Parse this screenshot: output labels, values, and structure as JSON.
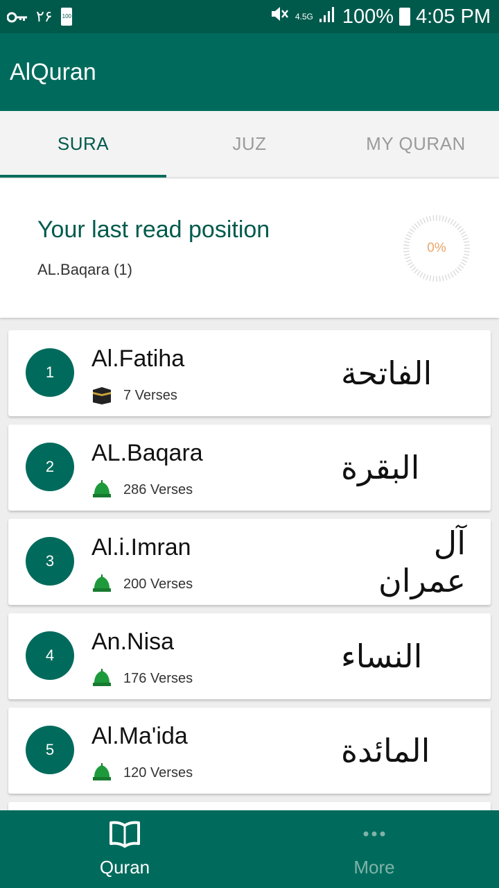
{
  "status_bar": {
    "left_text": "۲۶",
    "battery_small": "100",
    "network": "4.5G",
    "battery_percent": "100%",
    "time": "4:05 PM"
  },
  "app": {
    "title": "AlQuran"
  },
  "tabs": [
    {
      "label": "SURA",
      "active": true
    },
    {
      "label": "JUZ",
      "active": false
    },
    {
      "label": "MY QURAN",
      "active": false
    }
  ],
  "last_read": {
    "title": "Your last read position",
    "position": "AL.Baqara (1)",
    "progress_text": "0%",
    "progress_value": 0
  },
  "suras": [
    {
      "number": "1",
      "name": "Al.Fatiha",
      "verses": "7 Verses",
      "arabic": "الفاتحة",
      "icon": "kaaba-icon"
    },
    {
      "number": "2",
      "name": "AL.Baqara",
      "verses": "286 Verses",
      "arabic": "البقرة",
      "icon": "green-dome-icon"
    },
    {
      "number": "3",
      "name": "Al.i.Imran",
      "verses": "200 Verses",
      "arabic": "آل عمران",
      "icon": "green-dome-icon"
    },
    {
      "number": "4",
      "name": "An.Nisa",
      "verses": "176 Verses",
      "arabic": "النساء",
      "icon": "green-dome-icon"
    },
    {
      "number": "5",
      "name": "Al.Ma'ida",
      "verses": "120 Verses",
      "arabic": "المائدة",
      "icon": "green-dome-icon"
    }
  ],
  "bottom_nav": [
    {
      "label": "Quran",
      "icon": "book-icon",
      "active": true
    },
    {
      "label": "More",
      "icon": "more-dots-icon",
      "active": false
    }
  ],
  "colors": {
    "primary": "#006b5c",
    "primary_dark": "#005a4c",
    "progress_text": "#e8a66a"
  }
}
